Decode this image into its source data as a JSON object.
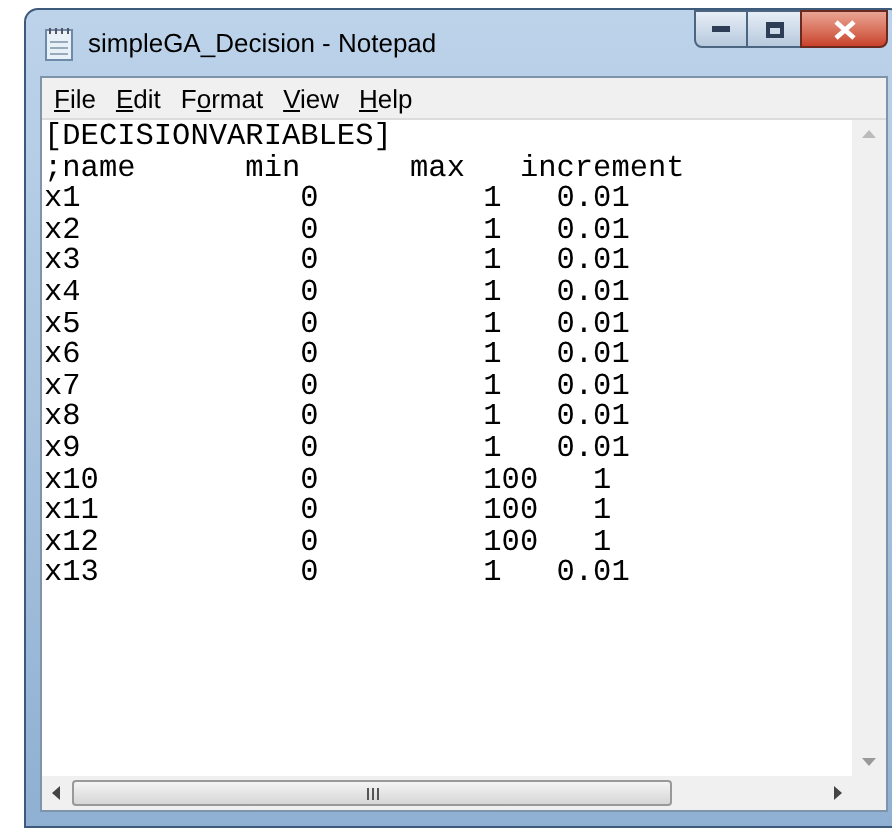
{
  "window": {
    "title": "simpleGA_Decision - Notepad"
  },
  "menu": [
    {
      "parts": [
        {
          "text": "F",
          "underlined": true
        },
        {
          "text": "ile",
          "underlined": false
        }
      ]
    },
    {
      "parts": [
        {
          "text": "E",
          "underlined": true
        },
        {
          "text": "dit",
          "underlined": false
        }
      ]
    },
    {
      "parts": [
        {
          "text": "F",
          "underlined": false
        },
        {
          "text": "o",
          "underlined": true
        },
        {
          "text": "rmat",
          "underlined": false
        }
      ]
    },
    {
      "parts": [
        {
          "text": "V",
          "underlined": true
        },
        {
          "text": "iew",
          "underlined": false
        }
      ]
    },
    {
      "parts": [
        {
          "text": "H",
          "underlined": true
        },
        {
          "text": "elp",
          "underlined": false
        }
      ]
    }
  ],
  "text_lines": [
    "[DECISIONVARIABLES]",
    ";name      min      max   increment",
    "x1            0         1   0.01",
    "x2            0         1   0.01",
    "x3            0         1   0.01",
    "x4            0         1   0.01",
    "x5            0         1   0.01",
    "x6            0         1   0.01",
    "x7            0         1   0.01",
    "x8            0         1   0.01",
    "x9            0         1   0.01",
    "x10           0         100   1",
    "x11           0         100   1",
    "x12           0         100   1",
    "x13           0         1   0.01"
  ]
}
